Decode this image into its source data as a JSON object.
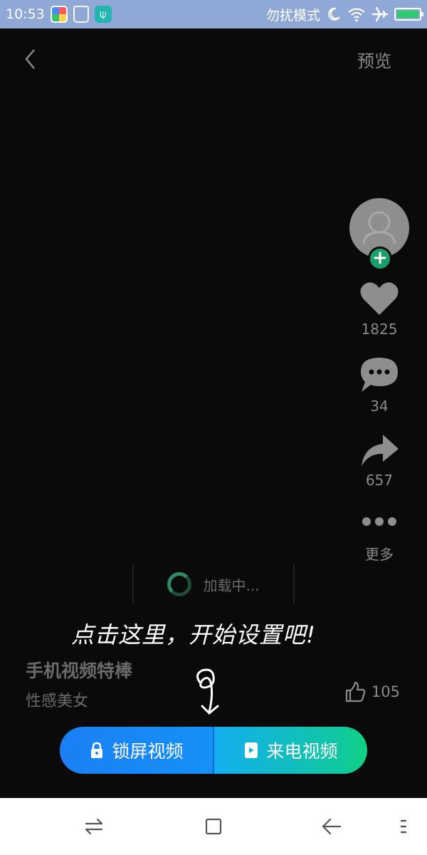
{
  "status_bar": {
    "time": "10:53",
    "dnd_mode": "勿扰模式",
    "icons": [
      "photos-app-icon",
      "brush-app-icon",
      "usb-icon",
      "moon-icon",
      "wifi-icon",
      "airplane-icon",
      "battery-icon"
    ],
    "battery_level": 1.0
  },
  "top_bar": {
    "back_icon": "chevron-left-icon",
    "preview_label": "预览"
  },
  "actions": {
    "like_count": "1825",
    "comment_count": "34",
    "share_count": "657",
    "more_label": "更多"
  },
  "loading": {
    "text": "加载中..."
  },
  "hint": {
    "text": "点击这里，开始设置吧!"
  },
  "video": {
    "title": "手机视频特棒",
    "subtitle": "性感美女",
    "thumb_count": "105"
  },
  "cta": {
    "lock_screen_label": "锁屏视频",
    "incoming_call_label": "来电视频"
  },
  "colors": {
    "status_bar": "#8fa8d6",
    "follow_green": "#1c9e6a",
    "cta_blue": "#1b7ff5",
    "cta_green": "#11d17f"
  }
}
